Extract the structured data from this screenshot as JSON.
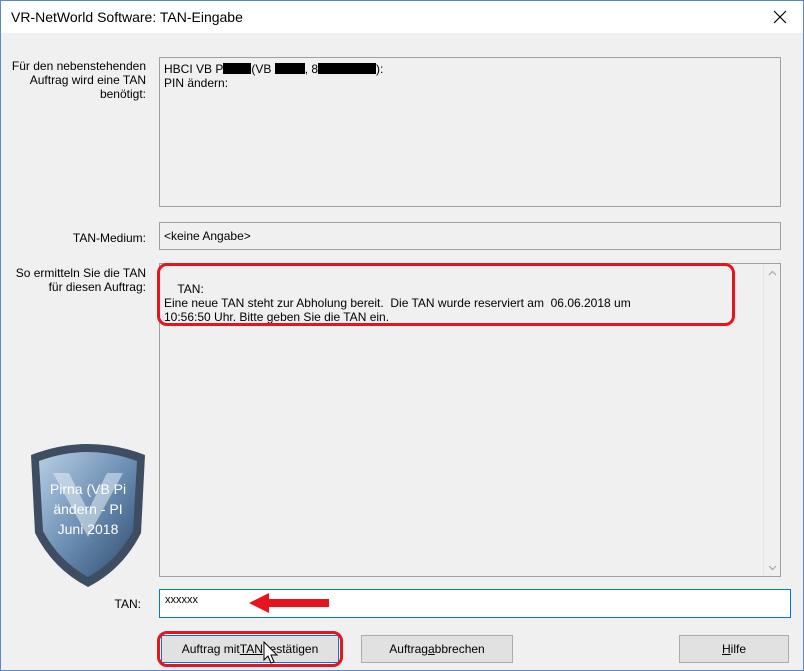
{
  "window": {
    "title": "VR-NetWorld Software: TAN-Eingabe"
  },
  "order": {
    "label": "Für den nebenstehenden Auftrag wird eine TAN benötigt:",
    "line1_a": "HBCI VB P",
    "line1_b": "(VB ",
    "line1_c": ", 8",
    "line1_d": "):",
    "line2": "PIN ändern:"
  },
  "medium": {
    "label": "TAN-Medium:",
    "value": "<keine Angabe>"
  },
  "instructions": {
    "label": "So ermitteln Sie die TAN für diesen Auftrag:",
    "text": "TAN:\nEine neue TAN steht zur Abholung bereit.  Die TAN wurde reserviert am  06.06.2018 um\n10:56:50 Uhr. Bitte geben Sie die TAN ein."
  },
  "watermark": {
    "lines": [
      "Pirna (VB Pi",
      "ändern - PI",
      "Juni 2018"
    ]
  },
  "tan": {
    "label": "TAN:",
    "value": "xxxxxx"
  },
  "buttons": {
    "confirm_pre": "Auftrag mit ",
    "confirm_u": "TAN",
    "confirm_post": " bestätigen",
    "cancel_pre": "Auftrag ",
    "cancel_u": "a",
    "cancel_post": "bbrechen",
    "help_u": "H",
    "help_post": "ilfe"
  },
  "colors": {
    "highlight": "#e8131c",
    "accent": "#0078d7"
  }
}
